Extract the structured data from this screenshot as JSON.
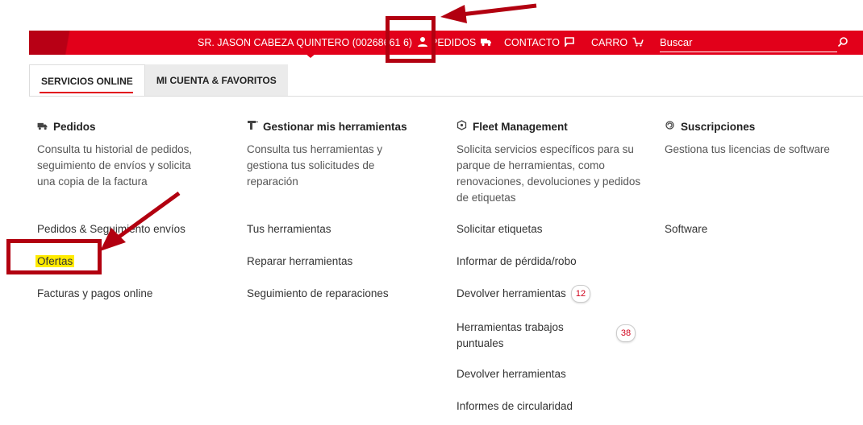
{
  "header": {
    "user_label": "SR. JASON CABEZA QUINTERO (00268661 6)",
    "orders_label": "PEDIDOS",
    "contact_label": "CONTACTO",
    "cart_label": "CARRO",
    "search_placeholder": "Buscar"
  },
  "tabs": [
    {
      "label": "SERVICIOS ONLINE",
      "active": true
    },
    {
      "label": "MI CUENTA & FAVORITOS",
      "active": false
    }
  ],
  "columns": [
    {
      "title": "Pedidos",
      "icon": "truck-icon",
      "description": "Consulta tu historial de pedidos, seguimiento de envíos y solicita una copia de la factura",
      "links": [
        {
          "label": "Pedidos & Seguimiento envíos"
        },
        {
          "label": "Ofertas",
          "highlighted": true
        },
        {
          "label": "Facturas y pagos online"
        }
      ]
    },
    {
      "title": "Gestionar mis herramientas",
      "icon": "drill-icon",
      "description": "Consulta tus herramientas y gestiona tus solicitudes de reparación",
      "links": [
        {
          "label": "Tus herramientas"
        },
        {
          "label": "Reparar herramientas"
        },
        {
          "label": "Seguimiento de reparaciones"
        }
      ]
    },
    {
      "title": "Fleet Management",
      "icon": "fleet-icon",
      "description": "Solicita servicios específicos para su parque de herramientas, como renovaciones, devoluciones y pedidos de etiquetas",
      "links": [
        {
          "label": "Solicitar etiquetas"
        },
        {
          "label": "Informar de pérdida/robo"
        },
        {
          "label": "Devolver herramientas",
          "badge": "12"
        },
        {
          "label": "Herramientas trabajos puntuales",
          "badge": "38"
        },
        {
          "label": "Devolver herramientas"
        },
        {
          "label": "Informes de circularidad"
        }
      ]
    },
    {
      "title": "Suscripciones",
      "icon": "subscription-icon",
      "description": "Gestiona tus licencias de software",
      "links": [
        {
          "label": "Software"
        }
      ]
    }
  ],
  "colors": {
    "brand_red": "#e2001a",
    "annotation_red": "#b20010",
    "highlight_yellow": "#ffeb00"
  }
}
